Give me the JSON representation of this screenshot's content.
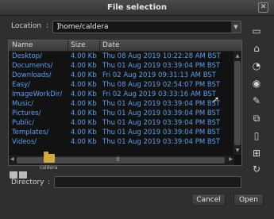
{
  "window": {
    "title": "File selection",
    "close_glyph": "✕"
  },
  "location": {
    "label": "Location",
    "colon": ":",
    "value": "]home/caldera"
  },
  "list": {
    "headers": {
      "name": "Name",
      "size": "Size",
      "date": "Date"
    },
    "rows": [
      {
        "name": "Desktop/",
        "size": "4.00 Kb",
        "date": "Thu 08 Aug 2019 10:22:28 AM BST"
      },
      {
        "name": "Documents/",
        "size": "4.00 Kb",
        "date": "Thu 01 Aug 2019 03:39:04 PM BST"
      },
      {
        "name": "Downloads/",
        "size": "4.00 Kb",
        "date": "Fri 02 Aug 2019 09:31:13 AM BST"
      },
      {
        "name": "Easy/",
        "size": "4.00 Kb",
        "date": "Thu 08 Aug 2019 02:54:07 PM BST"
      },
      {
        "name": "ImageWorkDir/",
        "size": "4.00 Kb",
        "date": "Fri 02 Aug 2019 03:33:16 AM BST"
      },
      {
        "name": "Music/",
        "size": "4.00 Kb",
        "date": "Thu 01 Aug 2019 03:39:04 PM BST"
      },
      {
        "name": "Pictures/",
        "size": "4.00 Kb",
        "date": "Thu 01 Aug 2019 03:39:04 PM BST"
      },
      {
        "name": "Public/",
        "size": "4.00 Kb",
        "date": "Thu 01 Aug 2019 03:39:04 PM BST"
      },
      {
        "name": "Templates/",
        "size": "4.00 Kb",
        "date": "Thu 01 Aug 2019 03:39:04 PM BST"
      },
      {
        "name": "Videos/",
        "size": "4.00 Kb",
        "date": "Thu 01 Aug 2019 03:39:04 PM BST"
      }
    ]
  },
  "bookmark": {
    "folder_caption": "caldera"
  },
  "directory": {
    "label": "Directory",
    "colon": ":",
    "value": ""
  },
  "buttons": {
    "cancel": "Cancel",
    "open": "Open"
  },
  "icons": {
    "side": [
      "new-folder-icon",
      "home-icon",
      "disc-icon",
      "cdrom-icon",
      "rename-icon",
      "copy-icon",
      "delete-icon",
      "add-bookmark-icon",
      "refresh-icon"
    ],
    "side_glyphs": [
      "▭",
      "⌂",
      "◔",
      "◉",
      "✎",
      "⧉",
      "▯",
      "⊞",
      "↻"
    ]
  },
  "colors": {
    "link": "#5a9ff0",
    "folder": "#d9a83a"
  }
}
